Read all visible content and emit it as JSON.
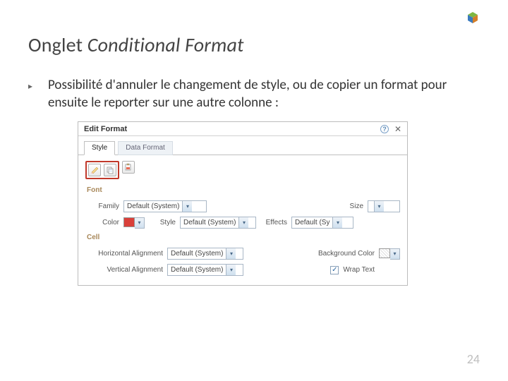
{
  "logo": {
    "name": "cube-logo"
  },
  "title": {
    "prefix": "Onglet ",
    "italic": "Conditional Format"
  },
  "bullet": {
    "text": "Possibilité d'annuler le changement de style, ou de copier un format pour ensuite le reporter sur une autre colonne :"
  },
  "dialog": {
    "title": "Edit Format",
    "tabs": [
      {
        "label": "Style",
        "active": true
      },
      {
        "label": "Data Format",
        "active": false
      }
    ],
    "tools": [
      {
        "name": "clear-format-icon"
      },
      {
        "name": "copy-format-icon"
      },
      {
        "name": "paste-format-icon"
      }
    ],
    "font": {
      "section": "Font",
      "family_label": "Family",
      "family_value": "Default (System)",
      "size_label": "Size",
      "size_value": "",
      "color_label": "Color",
      "color_value": "#d9403a",
      "style_label": "Style",
      "style_value": "Default (System)",
      "effects_label": "Effects",
      "effects_value": "Default (Sy"
    },
    "cell": {
      "section": "Cell",
      "halign_label": "Horizontal Alignment",
      "halign_value": "Default (System)",
      "valign_label": "Vertical Alignment",
      "valign_value": "Default (System)",
      "bgcolor_label": "Background Color",
      "wrap_label": "Wrap Text",
      "wrap_checked": true
    }
  },
  "page_number": "24"
}
